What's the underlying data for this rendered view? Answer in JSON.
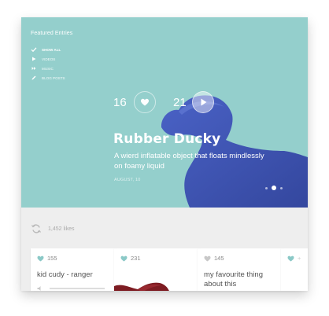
{
  "hero": {
    "section_title": "Featured Entries",
    "nav": [
      {
        "label": "Show All",
        "icon": "check-icon",
        "active": true
      },
      {
        "label": "Videos",
        "icon": "play-icon",
        "active": false
      },
      {
        "label": "Music",
        "icon": "music-icon",
        "active": false
      },
      {
        "label": "Blog Posts",
        "icon": "pencil-icon",
        "active": false
      }
    ],
    "likes_count": "16",
    "plays_count": "21",
    "title": "Rubber Ducky",
    "description": "A wierd inflatable object that floats mindlessly on foamy liquid",
    "date": "August, 10",
    "pager": {
      "pages": 3,
      "active_index": 1
    }
  },
  "feed": {
    "likes_total": "1,452 likes",
    "cards": [
      {
        "likes": "155",
        "title": "kid cudy - ranger",
        "type": "audio"
      },
      {
        "likes": "231",
        "title": "",
        "type": "image"
      },
      {
        "likes": "145",
        "title": "my favourite thing about this",
        "type": "text"
      },
      {
        "likes": "",
        "title": "",
        "type": "partial"
      }
    ]
  },
  "colors": {
    "hero_bg": "#94cfcc",
    "duck": "#3f55b8",
    "feed_bg": "#eeeeee",
    "heart": "#8bc9c7"
  }
}
